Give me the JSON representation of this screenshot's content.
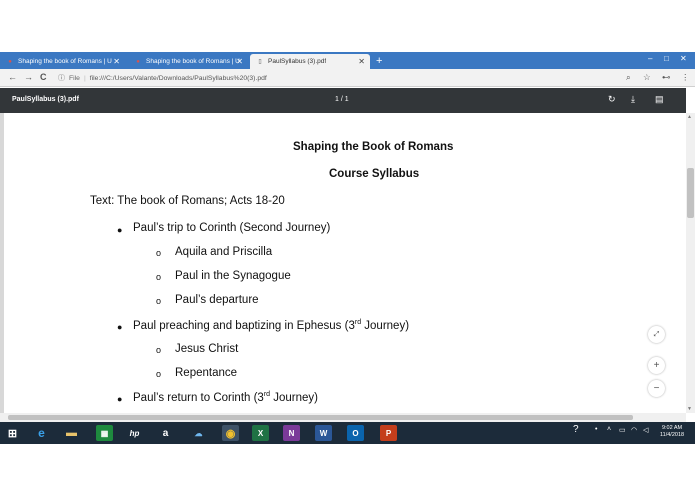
{
  "browser": {
    "tabs": [
      {
        "title": "Shaping the book of Romans | U",
        "close": "✕"
      },
      {
        "title": "Shaping the book of Romans | U",
        "close": "✕"
      },
      {
        "title": "PaulSyllabus (3).pdf",
        "close": "✕"
      }
    ],
    "new_tab": "+",
    "window_controls": {
      "minimize": "–",
      "maximize": "□",
      "close": "✕"
    },
    "nav": {
      "back": "←",
      "forward": "→",
      "reload": "C"
    },
    "address": {
      "info": "ⓘ",
      "scheme": "File",
      "url": "file:///C:/Users/Valante/Downloads/PaulSyllabus%20(3).pdf"
    },
    "right_icons": {
      "zoom": "🔍",
      "star": "☆",
      "extension": "⊷",
      "menu": "⋮"
    }
  },
  "pdf_toolbar": {
    "title": "PaulSyllabus (3).pdf",
    "page_indicator": "1 / 1",
    "icons": {
      "rotate": "rotate-icon",
      "download": "download-icon",
      "print": "print-icon"
    }
  },
  "document": {
    "title": "Shaping the Book of Romans",
    "subtitle": "Course Syllabus",
    "text_line": "Text: The book of Romans; Acts 18-20",
    "items": [
      {
        "label": "Paul’s trip to Corinth (Second Journey)"
      },
      {
        "label": "Aquila and Priscilla"
      },
      {
        "label": "Paul in the Synagogue"
      },
      {
        "label": "Paul’s departure"
      },
      {
        "pre": "Paul preaching and baptizing in Ephesus (3",
        "sup": "rd",
        "post": " Journey)"
      },
      {
        "label": "Jesus Christ"
      },
      {
        "label": "Repentance"
      },
      {
        "pre": "Paul’s return to Corinth (3",
        "sup": "rd",
        "post": " Journey)"
      }
    ],
    "bullet_glyph": "●",
    "sub_bullet_glyph": "o"
  },
  "zoom_controls": {
    "fit": "⤢",
    "plus": "+",
    "minus": "−"
  },
  "taskbar": {
    "apps": [
      "X",
      "N",
      "W",
      "O",
      "P"
    ],
    "clock_time": "9:02 AM",
    "clock_date": "11/4/2018"
  }
}
